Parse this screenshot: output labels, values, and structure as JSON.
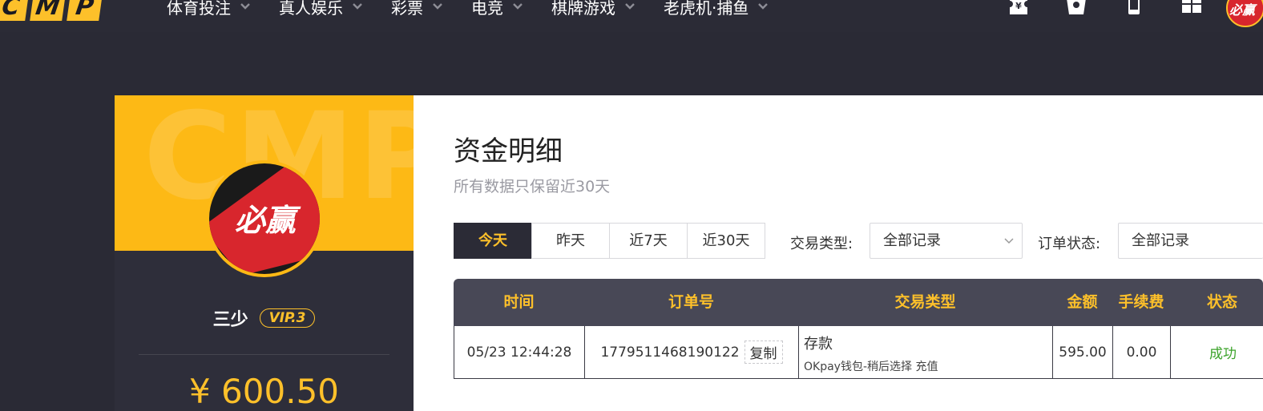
{
  "logo": {
    "letters": [
      "C",
      "M",
      "P"
    ]
  },
  "nav": {
    "items": [
      {
        "label": "体育投注"
      },
      {
        "label": "真人娱乐"
      },
      {
        "label": "彩票"
      },
      {
        "label": "电竞"
      },
      {
        "label": "棋牌游戏"
      },
      {
        "label": "老虎机·捕鱼"
      }
    ]
  },
  "top_icons": [
    "ticket-icon",
    "gift-box-icon",
    "mobile-icon",
    "grid-icon"
  ],
  "profile": {
    "avatar_text": "必赢",
    "username": "三少",
    "vip": "VIP.3",
    "balance": "¥ 600.50",
    "banner_watermark": "CMP"
  },
  "page": {
    "title": "资金明细",
    "subtitle": "所有数据只保留近30天"
  },
  "date_tabs": [
    {
      "label": "今天",
      "active": true
    },
    {
      "label": "昨天",
      "active": false
    },
    {
      "label": "近7天",
      "active": false
    },
    {
      "label": "近30天",
      "active": false
    }
  ],
  "filters": {
    "type_label": "交易类型:",
    "type_value": "全部记录",
    "status_label": "订单状态:",
    "status_value": "全部记录"
  },
  "table": {
    "headers": [
      "时间",
      "订单号",
      "交易类型",
      "金额",
      "手续费",
      "状态"
    ],
    "rows": [
      {
        "time": "05/23 12:44:28",
        "order_no": "1779511468190122",
        "copy_label": "复制",
        "type": "存款",
        "type_detail": "OKpay钱包-稍后选择 充值",
        "amount": "595.00",
        "fee": "0.00",
        "status": "成功"
      }
    ]
  },
  "colors": {
    "accent": "#fdc02a",
    "dark_bg": "#2a2a35",
    "success": "#3ba32a",
    "brand_red": "#d8262d"
  }
}
